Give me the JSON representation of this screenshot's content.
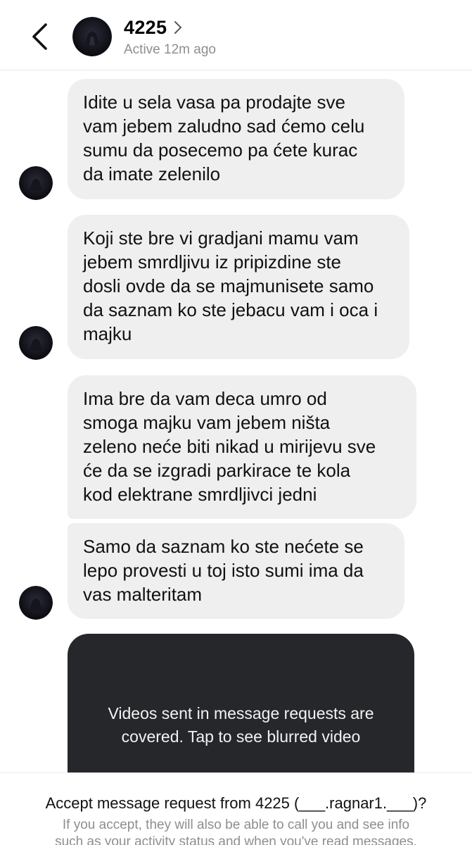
{
  "header": {
    "back_icon": "chevron-left-icon",
    "name": "4225",
    "name_chevron_icon": "chevron-right-icon",
    "status": "Active 12m ago"
  },
  "messages": [
    {
      "text": "Idite u sela vasa pa prodajte sve\nvam jebem zaludno sad ćemo celu\nsumu da posecemo pa  ćete kurac\nda imate zelenilo"
    },
    {
      "text": "Koji ste bre vi gradjani mamu vam\njebem smrdljivu iz pripizdine ste\ndosli ovde da se majmunisete samo\nda saznam ko ste jebacu vam i oca i\nmajku"
    },
    {
      "text": "Ima bre da vam deca umro od\nsmoga majku vam jebem ništa\nzeleno neće biti nikad u mirijevu sve\nće da se izgradi parkirace te kola\nkod elektrane smrdljivci jedni"
    },
    {
      "text": "Samo da saznam ko ste nećete se\nlepo provesti u toj isto sumi ima da\nvas malteritam"
    }
  ],
  "video_notice": {
    "text": "Videos sent in message requests are\ncovered. Tap to see blurred video"
  },
  "footer": {
    "title": "Accept message request from 4225 (___.ragnar1.___)?",
    "body": "If you accept, they will also be able to call you and see info\nsuch as your activity status and when you've read messages."
  },
  "colors": {
    "bubble_bg": "#efefef",
    "video_card_bg": "#26272b",
    "status_gray": "#8e8e8e"
  }
}
